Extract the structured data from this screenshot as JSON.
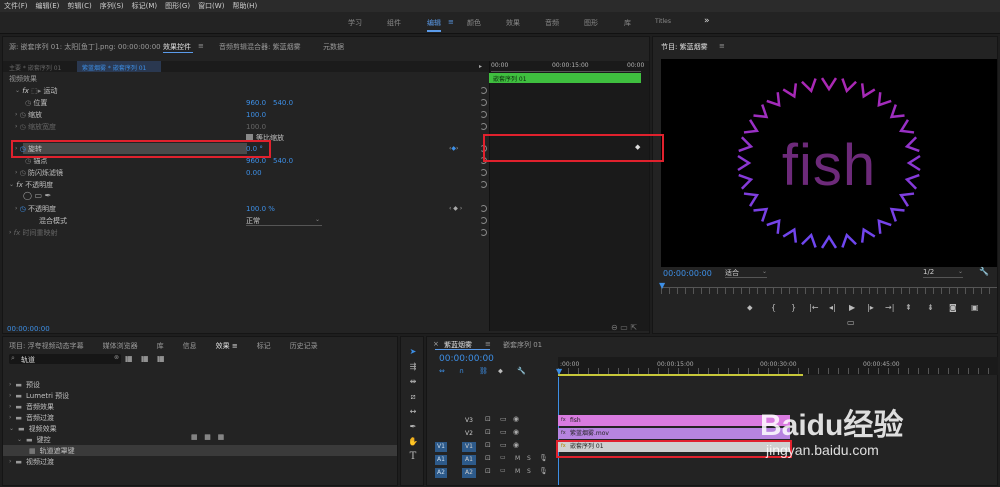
{
  "menu": [
    "文件(F)",
    "编辑(E)",
    "剪辑(C)",
    "序列(S)",
    "标记(M)",
    "图形(G)",
    "窗口(W)",
    "帮助(H)"
  ],
  "workspaces": {
    "learn": "学习",
    "assembly": "组件",
    "edit": "编辑",
    "edit_menu": "≡",
    "color": "颜色",
    "effects": "效果",
    "audio": "音频",
    "graphics": "图形",
    "library": "库",
    "titles": "Titles",
    "more": "»"
  },
  "source_panel": {
    "tab_source": "源: 嵌套序列 01: 太阳[鱼丁].png: 00:00:00:00",
    "tab_effect_controls": "效果控件",
    "tab_menu": "≡",
    "tab_audio_mixer": "音频剪辑混合器: 紫蓝烟雾",
    "tab_metadata": "元数据",
    "breadcrumb_main": "主要 * 嵌套序列 01",
    "breadcrumb_seq": "紫蓝烟雾 * 嵌套序列 01",
    "ruler_start": "00:00",
    "ruler_mid": "00:00:15:00",
    "ruler_end": "00:00",
    "clip_label": "嵌套序列 01",
    "section_video": "视频效果",
    "fx": "fx",
    "motion": "运动",
    "position": "位置",
    "position_x": "960.0",
    "position_y": "540.0",
    "scale": "缩放",
    "scale_val": "100.0",
    "scale_width": "缩放宽度",
    "scale_width_val": "100.0",
    "uniform_scale": "等比缩放",
    "rotation": "旋转",
    "rotation_val": "0.0 °",
    "anchor": "锚点",
    "anchor_x": "960.0",
    "anchor_y": "540.0",
    "antiflicker": "防闪烁滤镜",
    "antiflicker_val": "0.00",
    "opacity_section": "不透明度",
    "opacity": "不透明度",
    "opacity_val": "100.0 %",
    "blend_mode": "混合模式",
    "blend_val": "正常",
    "time_remap": "时间重映射",
    "timecode": "00:00:00:00"
  },
  "program_panel": {
    "title": "节目: 紫蓝烟雾",
    "menu": "≡",
    "word": "fish",
    "timecode": "00:00:00:00",
    "fit": "适合",
    "res": "1/2"
  },
  "project_panel": {
    "tabs": [
      "项目: 浮夸视频动态字幕",
      "媒体浏览器",
      "库",
      "信息",
      "效果",
      "标记",
      "历史记录"
    ],
    "active_tab": "效果",
    "search": "轨道",
    "tree": [
      {
        "label": "预设",
        "indent": 0,
        "open": false
      },
      {
        "label": "Lumetri 预设",
        "indent": 0,
        "open": false
      },
      {
        "label": "音频效果",
        "indent": 0,
        "open": false
      },
      {
        "label": "音频过渡",
        "indent": 0,
        "open": false
      },
      {
        "label": "视频效果",
        "indent": 0,
        "open": true
      },
      {
        "label": "键控",
        "indent": 1,
        "open": true
      },
      {
        "label": "轨道遮罩键",
        "indent": 2,
        "open": false,
        "selected": true
      },
      {
        "label": "视频过渡",
        "indent": 0,
        "open": false
      }
    ]
  },
  "timeline_panel": {
    "tab_active": "紫蓝烟雾",
    "tab_menu": "≡",
    "tab_other": "嵌套序列 01",
    "timecode": "00:00:00:00",
    "ruler": [
      ":00:00",
      "00:00:15:00",
      "00:00:30:00",
      "00:00:45:00"
    ],
    "tracks": [
      {
        "id": "V3",
        "clip": "fish",
        "color": "#d97be0"
      },
      {
        "id": "V2",
        "clip": "紫蓝烟雾.mov",
        "color": "#b784e0"
      },
      {
        "id": "V1",
        "src": "V1",
        "clip": "嵌套序列 01",
        "color": "#cfcfcf"
      },
      {
        "id": "A1",
        "src": "A1",
        "m": "M",
        "s": "S"
      },
      {
        "id": "A2",
        "src": "A2",
        "m": "M",
        "s": "S"
      }
    ]
  },
  "watermark": {
    "brand": "Baidu经验",
    "url": "jingyan.baidu.com"
  }
}
